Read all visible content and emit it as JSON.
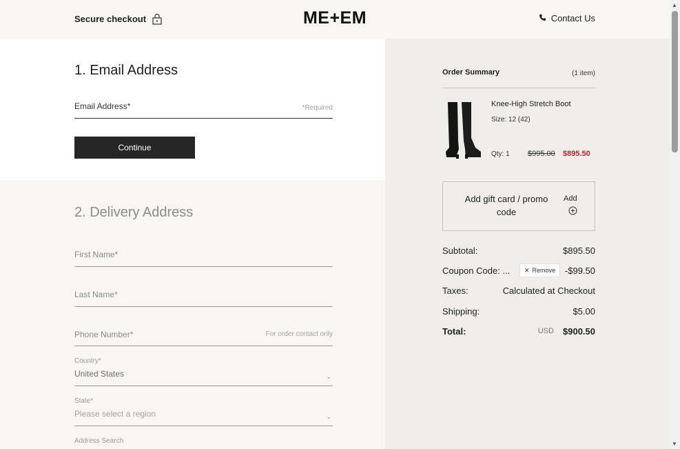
{
  "header": {
    "secure_label": "Secure checkout",
    "logo": "ME+EM",
    "contact_label": "Contact Us"
  },
  "email_step": {
    "title": "1. Email Address",
    "email_label": "Email Address*",
    "required_hint": "*Required",
    "continue_label": "Continue"
  },
  "delivery_step": {
    "title": "2. Delivery Address",
    "first_name_label": "First Name*",
    "last_name_label": "Last Name*",
    "phone_label": "Phone Number*",
    "phone_hint": "For order contact only",
    "country_label": "Country*",
    "country_value": "United States",
    "state_label": "State*",
    "state_placeholder": "Please select a region",
    "address_search_label": "Address Search"
  },
  "summary": {
    "title": "Order Summary",
    "count": "(1 item)",
    "item": {
      "name": "Knee-High Stretch Boot",
      "size": "Size: 12 (42)",
      "qty": "Qty: 1",
      "price_original": "$995.00",
      "price_sale": "$895.50"
    },
    "promo_label": "Add gift card / promo code",
    "promo_add": "Add",
    "subtotal_label": "Subtotal:",
    "subtotal_value": "$895.50",
    "coupon_label": "Coupon Code: ...",
    "remove_label": "Remove",
    "coupon_value": "-$99.50",
    "taxes_label": "Taxes:",
    "taxes_value": "Calculated at Checkout",
    "shipping_label": "Shipping:",
    "shipping_value": "$5.00",
    "total_label": "Total:",
    "currency": "USD",
    "total_value": "$900.50"
  },
  "colors": {
    "sale_red": "#b32826",
    "button_dark": "#262626",
    "panel_bg": "#efeeea"
  }
}
